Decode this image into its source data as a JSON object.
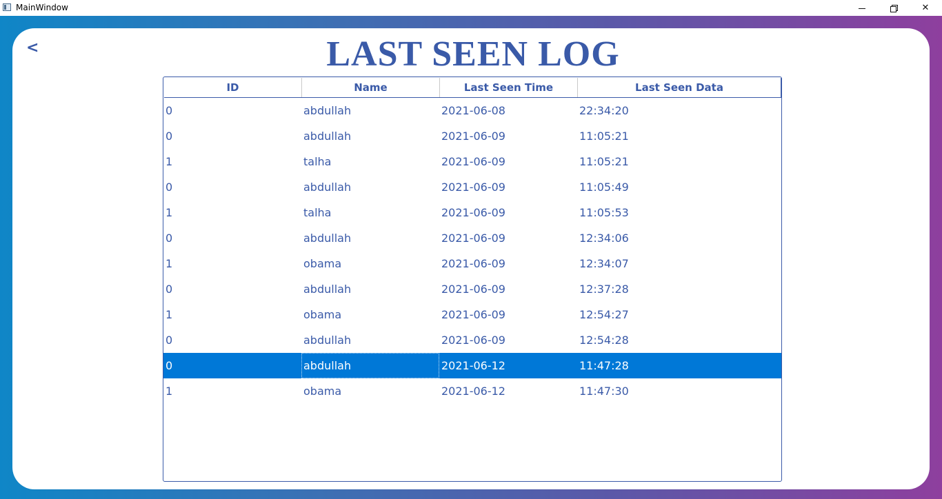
{
  "window": {
    "title": "MainWindow",
    "minimize": "minimize",
    "restore": "restore",
    "close": "✕"
  },
  "page": {
    "back_label": "<",
    "title": "LAST SEEN LOG"
  },
  "table": {
    "columns": [
      "ID",
      "Name",
      "Last Seen Time",
      "Last Seen Data"
    ],
    "rows": [
      {
        "id": "0",
        "name": "abdullah",
        "date": "2021-06-08",
        "time": "22:34:20"
      },
      {
        "id": "0",
        "name": "abdullah",
        "date": "2021-06-09",
        "time": "11:05:21"
      },
      {
        "id": "1",
        "name": "talha",
        "date": "2021-06-09",
        "time": "11:05:21"
      },
      {
        "id": "0",
        "name": "abdullah",
        "date": "2021-06-09",
        "time": "11:05:49"
      },
      {
        "id": "1",
        "name": "talha",
        "date": "2021-06-09",
        "time": "11:05:53"
      },
      {
        "id": "0",
        "name": "abdullah",
        "date": "2021-06-09",
        "time": "12:34:06"
      },
      {
        "id": "1",
        "name": "obama",
        "date": "2021-06-09",
        "time": "12:34:07"
      },
      {
        "id": "0",
        "name": "abdullah",
        "date": "2021-06-09",
        "time": "12:37:28"
      },
      {
        "id": "1",
        "name": "obama",
        "date": "2021-06-09",
        "time": "12:54:27"
      },
      {
        "id": "0",
        "name": "abdullah",
        "date": "2021-06-09",
        "time": "12:54:28"
      },
      {
        "id": "0",
        "name": "abdullah",
        "date": "2021-06-12",
        "time": "11:47:28"
      },
      {
        "id": "1",
        "name": "obama",
        "date": "2021-06-12",
        "time": "11:47:30"
      }
    ],
    "selected_row": 10
  },
  "colors": {
    "accent": "#3a5aa8",
    "selection": "#0078d7",
    "gradient_start": "#0f86c7",
    "gradient_end": "#8e3f9e"
  }
}
